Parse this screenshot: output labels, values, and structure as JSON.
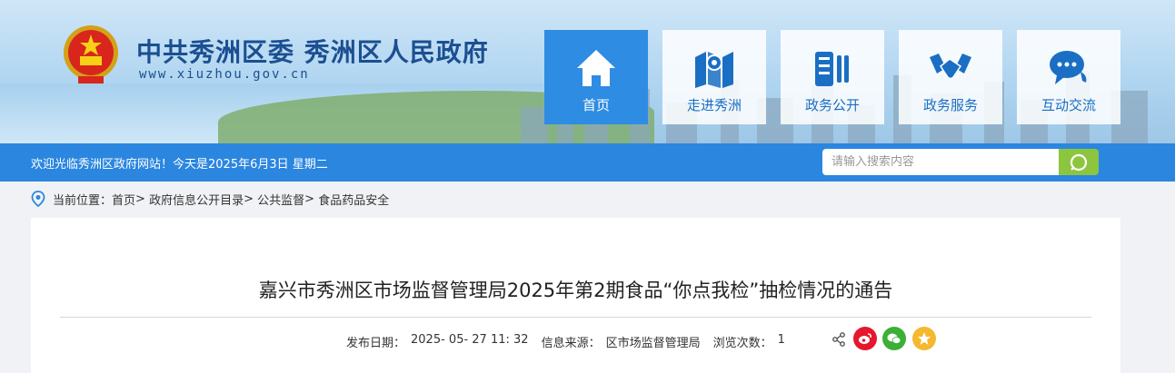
{
  "header": {
    "site_title": "中共秀洲区委 秀洲区人民政府",
    "site_url": "www.xiuzhou.gov.cn",
    "logo_icon": "national-emblem-icon",
    "nav": [
      {
        "label": "首页",
        "icon": "home-icon",
        "active": true
      },
      {
        "label": "走进秀洲",
        "icon": "map-pin-icon",
        "active": false
      },
      {
        "label": "政务公开",
        "icon": "document-icon",
        "active": false
      },
      {
        "label": "政务服务",
        "icon": "handshake-icon",
        "active": false
      },
      {
        "label": "互动交流",
        "icon": "chat-icon",
        "active": false
      }
    ]
  },
  "topbar": {
    "welcome": "欢迎光临秀洲区政府网站！今天是2025年6月3日 星期二",
    "search_placeholder": "请输入搜索内容"
  },
  "breadcrumb": {
    "prefix": "当前位置：",
    "items": [
      "首页",
      "政府信息公开目录",
      "公共监督",
      "食品药品安全"
    ],
    "separator": ">"
  },
  "article": {
    "title": "嘉兴市秀洲区市场监督管理局2025年第2期食品“你点我检”抽检情况的通告",
    "publish_label": "发布日期：",
    "publish_date": "2025- 05- 27 11: 32",
    "source_label": "信息来源：",
    "source": "区市场监督管理局",
    "views_label": "浏览次数：",
    "views": "1"
  },
  "share": {
    "icons": [
      "share-icon",
      "weibo-icon",
      "wechat-icon",
      "qzone-icon"
    ],
    "colors": {
      "weibo": "#e6162d",
      "wechat": "#3cb034",
      "qzone": "#f5b82e"
    }
  },
  "colors": {
    "accent": "#2b86e0",
    "nav_active": "#2e8ce3",
    "search_button": "#8cc63f",
    "title": "#1b4f91"
  }
}
